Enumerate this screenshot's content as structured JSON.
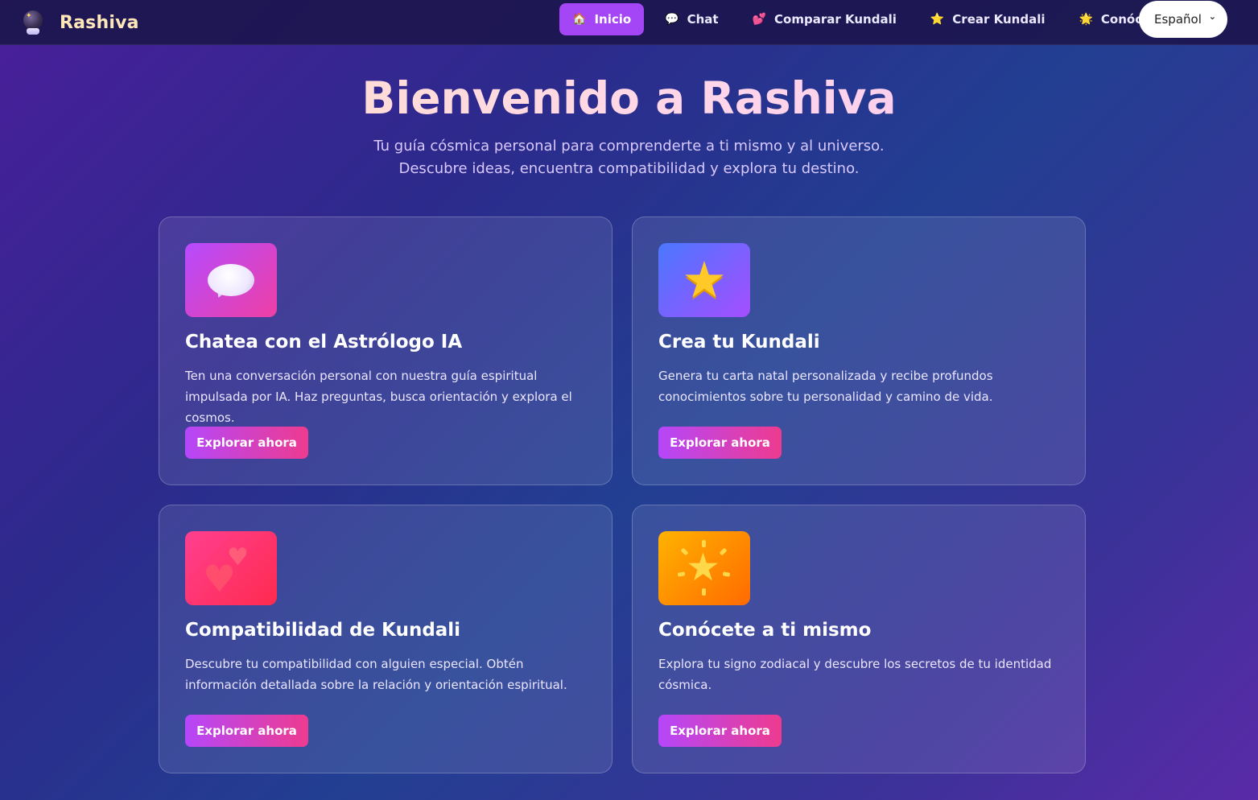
{
  "brand": {
    "name": "Rashiva"
  },
  "nav": {
    "items": [
      {
        "icon": "house-icon",
        "glyph": "🏠",
        "label": "Inicio",
        "active": true
      },
      {
        "icon": "speech-bubble-icon",
        "glyph": "💬",
        "label": "Chat",
        "active": false
      },
      {
        "icon": "hearts-icon",
        "glyph": "💕",
        "label": "Comparar Kundali",
        "active": false
      },
      {
        "icon": "star-icon",
        "glyph": "⭐",
        "label": "Crear Kundali",
        "active": false
      },
      {
        "icon": "sparkle-star-icon",
        "glyph": "🌟",
        "label": "Conócete",
        "active": false
      }
    ],
    "language": "Español"
  },
  "hero": {
    "title": "Bienvenido a Rashiva",
    "subtitle_line1": "Tu guía cósmica personal para comprenderte a ti mismo y al universo.",
    "subtitle_line2": "Descubre ideas, encuentra compatibilidad y explora tu destino."
  },
  "cards": [
    {
      "icon": "speech-bubble-icon",
      "title": "Chatea con el Astrólogo IA",
      "description": "Ten una conversación personal con nuestra guía espiritual impulsada por IA. Haz preguntas, busca orientación y explora el cosmos.",
      "button": "Explorar ahora"
    },
    {
      "icon": "star-icon",
      "title": "Crea tu Kundali",
      "description": "Genera tu carta natal personalizada y recibe profundos conocimientos sobre tu personalidad y camino de vida.",
      "button": "Explorar ahora"
    },
    {
      "icon": "two-hearts-icon",
      "title": "Compatibilidad de Kundali",
      "description": "Descubre tu compatibilidad con alguien especial. Obtén información detallada sobre la relación y orientación espiritual.",
      "button": "Explorar ahora"
    },
    {
      "icon": "glowing-star-icon",
      "title": "Conócete a ti mismo",
      "description": "Explora tu signo zodiacal y descubre los secretos de tu identidad cósmica.",
      "button": "Explorar ahora"
    }
  ],
  "colors": {
    "accent": "#a546f6",
    "button_gradient_start": "#b547fa",
    "button_gradient_end": "#ee3b8f",
    "brand_text": "#fde7b8"
  }
}
